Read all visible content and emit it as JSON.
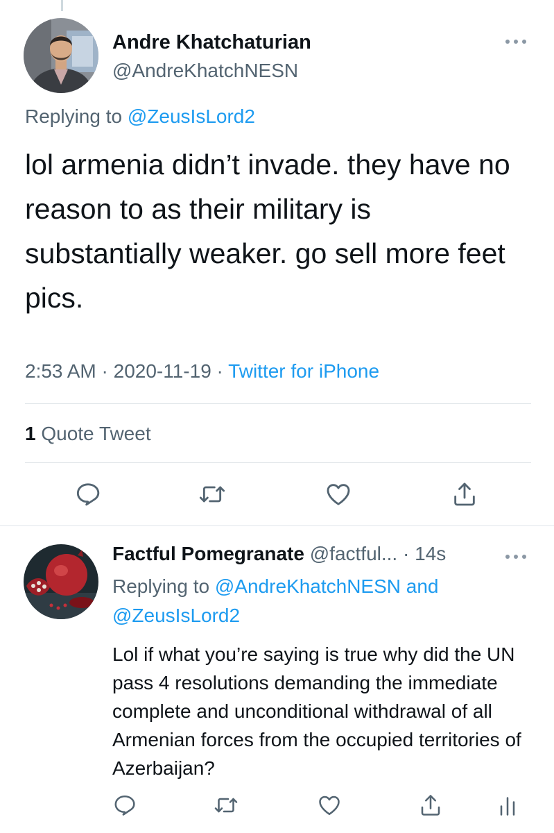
{
  "main_tweet": {
    "display_name": "Andre Khatchaturian",
    "handle": "@AndreKhatchNESN",
    "replying_prefix": "Replying to ",
    "replying_to": "@ZeusIsLord2",
    "text": "lol armenia didn’t invade. they have no reason to as their military is substantially weaker. go sell more feet pics.",
    "time": "2:53 AM",
    "date": "2020-11-19",
    "source": "Twitter for iPhone",
    "separator": " · ",
    "quote_count": "1",
    "quote_label": " Quote Tweet",
    "actions": [
      "reply-icon",
      "retweet-icon",
      "like-icon",
      "share-icon"
    ]
  },
  "reply_tweet": {
    "display_name": "Factful Pomegranate",
    "handle": "@factful...",
    "age": "14s",
    "separator": " · ",
    "replying_prefix": "Replying to ",
    "replying_to_1": "@AndreKhatchNESN",
    "replying_and": " and",
    "replying_to_2": "@ZeusIsLord2",
    "text": "Lol if what you’re saying is true why did the UN pass 4 resolutions demanding the immediate complete and unconditional withdrawal of all Armenian forces from the occupied territories of Azerbaijan?",
    "actions": [
      "reply-icon",
      "retweet-icon",
      "like-icon",
      "share-icon",
      "analytics-icon"
    ]
  },
  "colors": {
    "text_primary": "#0f1419",
    "text_secondary": "#536471",
    "link": "#1d9bf0",
    "divider": "#e1e6ea"
  }
}
